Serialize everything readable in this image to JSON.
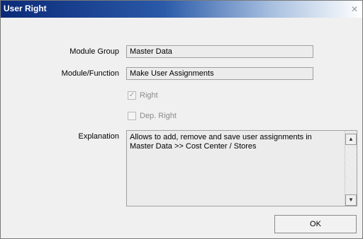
{
  "window": {
    "title": "User Right",
    "close_icon": "close-icon",
    "close_glyph": "✕"
  },
  "form": {
    "module_group": {
      "label": "Module Group",
      "value": "Master Data"
    },
    "module_function": {
      "label": "Module/Function",
      "value": "Make User Assignments"
    },
    "right": {
      "label": "Right",
      "checked": true,
      "enabled": false,
      "glyph": "✓"
    },
    "dep_right": {
      "label": "Dep. Right",
      "checked": false,
      "enabled": false,
      "glyph": ""
    },
    "explanation": {
      "label": "Explanation",
      "line1": "Allows to add, remove and save user assignments in",
      "line2": "Master Data >> Cost Center / Stores"
    },
    "scroll_up_glyph": "▲",
    "scroll_down_glyph": "▼"
  },
  "buttons": {
    "ok_label": "OK"
  }
}
